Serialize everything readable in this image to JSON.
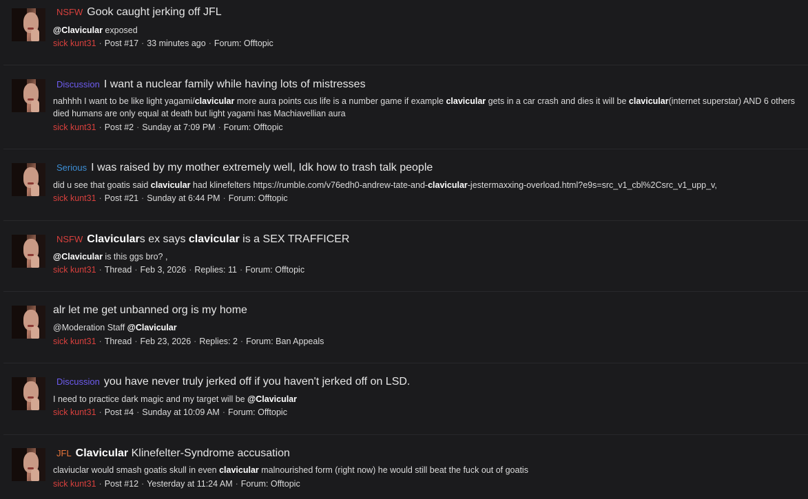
{
  "colors": {
    "background": "#1b1b1d",
    "author": "#d8403d",
    "prefix_nsfw": "#d8403d",
    "prefix_discussion": "#6e5cf0",
    "prefix_serious": "#3d8fd6",
    "prefix_jfl": "#e8743a"
  },
  "results": [
    {
      "prefix": "NSFW",
      "title_parts": [
        {
          "t": "Gook caught jerking off JFL",
          "b": false
        }
      ],
      "snippet_parts": [
        {
          "t": "@Clavicular",
          "b": true
        },
        {
          "t": " exposed",
          "b": false
        }
      ],
      "author": "sick kunt31",
      "meta": [
        "Post #17",
        "33 minutes ago",
        "Forum: Offtopic"
      ]
    },
    {
      "prefix": "Discussion",
      "title_parts": [
        {
          "t": "I want a nuclear family while having lots of mistresses",
          "b": false
        }
      ],
      "snippet_parts": [
        {
          "t": "nahhhh I want to be like light yagami/",
          "b": false
        },
        {
          "t": "clavicular",
          "b": true
        },
        {
          "t": " more aura points cus life is a number game if example ",
          "b": false
        },
        {
          "t": "clavicular",
          "b": true
        },
        {
          "t": " gets in a car crash and dies it will be ",
          "b": false
        },
        {
          "t": "clavicular",
          "b": true
        },
        {
          "t": "(internet superstar) AND 6 others died humans are only equal at death but light yagami has Machiavellian aura",
          "b": false
        }
      ],
      "author": "sick kunt31",
      "meta": [
        "Post #2",
        "Sunday at 7:09 PM",
        "Forum: Offtopic"
      ]
    },
    {
      "prefix": "Serious",
      "title_parts": [
        {
          "t": "I was raised by my mother extremely well, Idk how to trash talk people",
          "b": false
        }
      ],
      "snippet_parts": [
        {
          "t": "did u see that goatis said ",
          "b": false
        },
        {
          "t": "clavicular",
          "b": true
        },
        {
          "t": " had klinefelters https://rumble.com/v76edh0-andrew-tate-and-",
          "b": false
        },
        {
          "t": "clavicular",
          "b": true
        },
        {
          "t": "-jestermaxxing-overload.html?e9s=src_v1_cbl%2Csrc_v1_upp_v,",
          "b": false
        }
      ],
      "author": "sick kunt31",
      "meta": [
        "Post #21",
        "Sunday at 6:44 PM",
        "Forum: Offtopic"
      ]
    },
    {
      "prefix": "NSFW",
      "title_parts": [
        {
          "t": "Clavicular",
          "b": true
        },
        {
          "t": "s ex says ",
          "b": false
        },
        {
          "t": "clavicular",
          "b": true
        },
        {
          "t": " is a SEX TRAFFICER",
          "b": false
        }
      ],
      "snippet_parts": [
        {
          "t": "@Clavicular",
          "b": true
        },
        {
          "t": " is this ggs bro? ,",
          "b": false
        }
      ],
      "author": "sick kunt31",
      "meta": [
        "Thread",
        "Feb 3, 2026",
        "Replies: 11",
        "Forum: Offtopic"
      ]
    },
    {
      "prefix": "",
      "title_parts": [
        {
          "t": "alr let me get unbanned org is my home",
          "b": false
        }
      ],
      "snippet_parts": [
        {
          "t": "@Moderation Staff ",
          "b": false
        },
        {
          "t": "@Clavicular",
          "b": true
        }
      ],
      "author": "sick kunt31",
      "meta": [
        "Thread",
        "Feb 23, 2026",
        "Replies: 2",
        "Forum: Ban Appeals"
      ]
    },
    {
      "prefix": "Discussion",
      "title_parts": [
        {
          "t": "you have never truly jerked off if you haven't jerked off on LSD.",
          "b": false
        }
      ],
      "snippet_parts": [
        {
          "t": "I need to practice dark magic and my target will be ",
          "b": false
        },
        {
          "t": "@Clavicular",
          "b": true
        }
      ],
      "author": "sick kunt31",
      "meta": [
        "Post #4",
        "Sunday at 10:09 AM",
        "Forum: Offtopic"
      ]
    },
    {
      "prefix": "JFL",
      "title_parts": [
        {
          "t": "Clavicular",
          "b": true
        },
        {
          "t": " Klinefelter-Syndrome accusation",
          "b": false
        }
      ],
      "snippet_parts": [
        {
          "t": "claviuclar would smash goatis skull in even ",
          "b": false
        },
        {
          "t": "clavicular",
          "b": true
        },
        {
          "t": " malnourished form (right now) he would still beat the fuck out of goatis",
          "b": false
        }
      ],
      "author": "sick kunt31",
      "meta": [
        "Post #12",
        "Yesterday at 11:24 AM",
        "Forum: Offtopic"
      ]
    }
  ]
}
